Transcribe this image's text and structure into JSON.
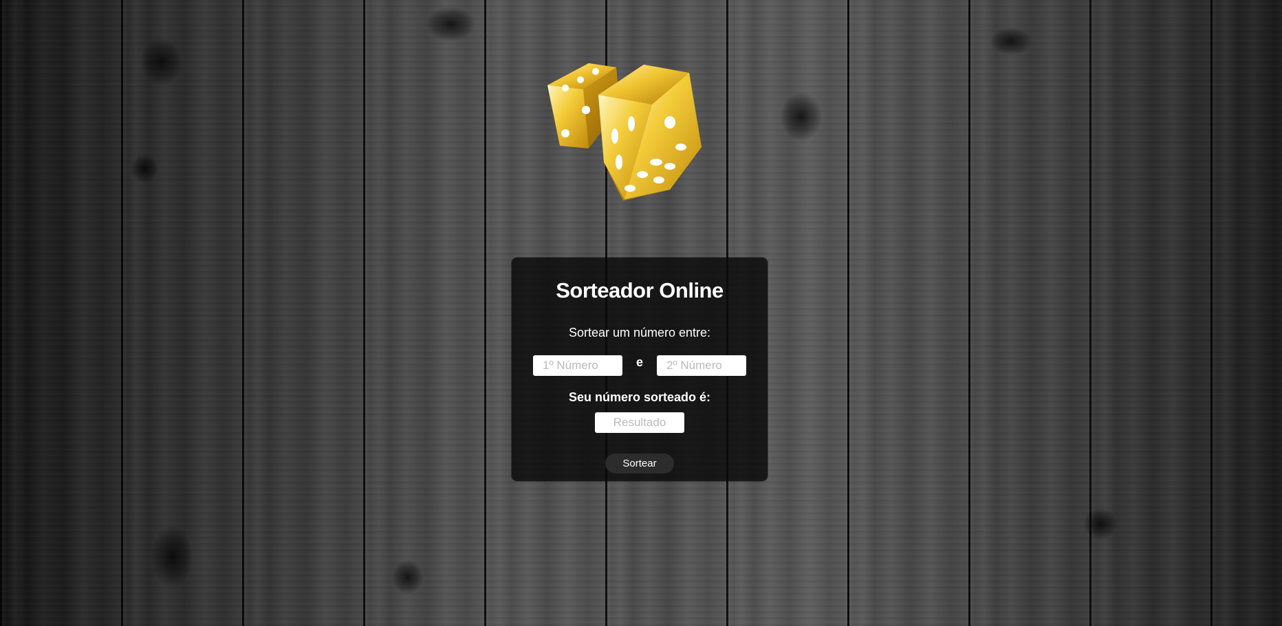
{
  "app": {
    "title": "Sorteador Online"
  },
  "form": {
    "subtitle": "Sortear um número entre:",
    "first_number_placeholder": "1º Número",
    "first_number_value": "",
    "connector": "e",
    "second_number_placeholder": "2º Número",
    "second_number_value": "",
    "result_label": "Seu número sorteado é:",
    "result_placeholder": "Resultado",
    "result_value": "",
    "draw_button_label": "Sortear"
  },
  "icons": {
    "hero": "dice-icon"
  },
  "colors": {
    "card_background": "#0a0a0a",
    "dice_gold": "#e8b820",
    "text": "#ffffff",
    "button_background": "#2c2c2c"
  }
}
